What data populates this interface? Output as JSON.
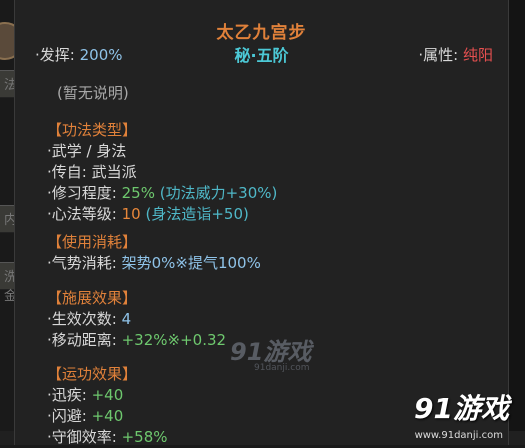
{
  "tooltip": {
    "title": "太乙九宫步",
    "rank": "秘·五阶",
    "effectiveness_label": "·发挥:",
    "effectiveness_value": "200%",
    "attribute_label": "·属性:",
    "attribute_value": "纯阳",
    "description": "(暂无说明)"
  },
  "sections": {
    "type": {
      "title": "【功法类型】",
      "category": "·武学 / 身法",
      "origin_label": "·传自:",
      "origin_value": "武当派",
      "mastery_label": "·修习程度:",
      "mastery_value": "25%",
      "mastery_bonus": "(功法威力+30%)",
      "level_label": "·心法等级:",
      "level_value": "10",
      "level_bonus": "(身法造诣+50)"
    },
    "cost": {
      "title": "【使用消耗】",
      "qi_label": "·气势消耗:",
      "qi_value": "架势0%※提气100%"
    },
    "cast": {
      "title": "【施展效果】",
      "times_label": "·生效次数:",
      "times_value": "4",
      "move_label": "·移动距离:",
      "move_value": "+32%※+0.32"
    },
    "run": {
      "title": "【运功效果】",
      "swift_label": "·迅疾:",
      "swift_value": "+40",
      "dodge_label": "·闪避:",
      "dodge_value": "+40",
      "defense_label": "·守御效率:",
      "defense_value": "+58%"
    }
  },
  "background": {
    "strip1": "法",
    "strip2": "内功",
    "strip3": "洗髓金丝"
  },
  "watermark": {
    "center": "91游戏",
    "center_url": "91danji.com",
    "corner": "91游戏",
    "corner_url": "www.91danji.com"
  }
}
